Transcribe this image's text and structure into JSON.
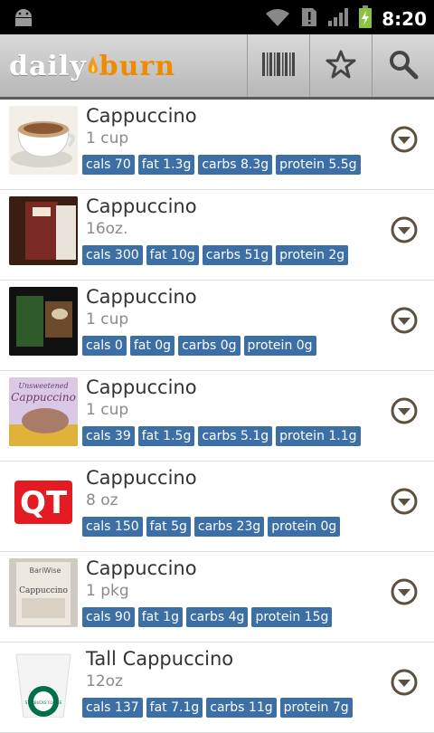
{
  "status": {
    "time": "8:20"
  },
  "app": {
    "logo_part1": "daily",
    "logo_part2": "burn"
  },
  "foods": [
    {
      "name": "Cappuccino",
      "amount": "1 cup",
      "tags": [
        "cals 70",
        "fat 1.3g",
        "carbs 8.3g",
        "protein 5.5g"
      ]
    },
    {
      "name": "Cappuccino",
      "amount": "16oz.",
      "tags": [
        "cals 300",
        "fat 10g",
        "carbs 51g",
        "protein 2g"
      ]
    },
    {
      "name": "Cappuccino",
      "amount": "1 cup",
      "tags": [
        "cals 0",
        "fat 0g",
        "carbs 0g",
        "protein 0g"
      ]
    },
    {
      "name": "Cappuccino",
      "amount": "1 cup",
      "tags": [
        "cals 39",
        "fat 1.5g",
        "carbs 5.1g",
        "protein 1.1g"
      ]
    },
    {
      "name": "Cappuccino",
      "amount": "8 oz",
      "tags": [
        "cals 150",
        "fat 5g",
        "carbs 23g",
        "protein 0g"
      ]
    },
    {
      "name": "Cappuccino",
      "amount": "1 pkg",
      "tags": [
        "cals 90",
        "fat 1g",
        "carbs 4g",
        "protein 15g"
      ]
    },
    {
      "name": "Tall Cappuccino",
      "amount": "12oz",
      "tags": [
        "cals 137",
        "fat 7.1g",
        "carbs 11g",
        "protein 7g"
      ]
    }
  ],
  "thumb_text": {
    "qt": "QT",
    "unsweetened_line1": "Unsweetened",
    "unsweetened_line2": "Cappuccino",
    "bariwise_brand": "BariWise",
    "bariwise_product": "Cappuccino",
    "starbucks": "STARBUCKS COFFEE"
  },
  "colors": {
    "tag_bg": "#3c6fa6",
    "accent": "#f08a00",
    "icon": "#5d5041"
  }
}
